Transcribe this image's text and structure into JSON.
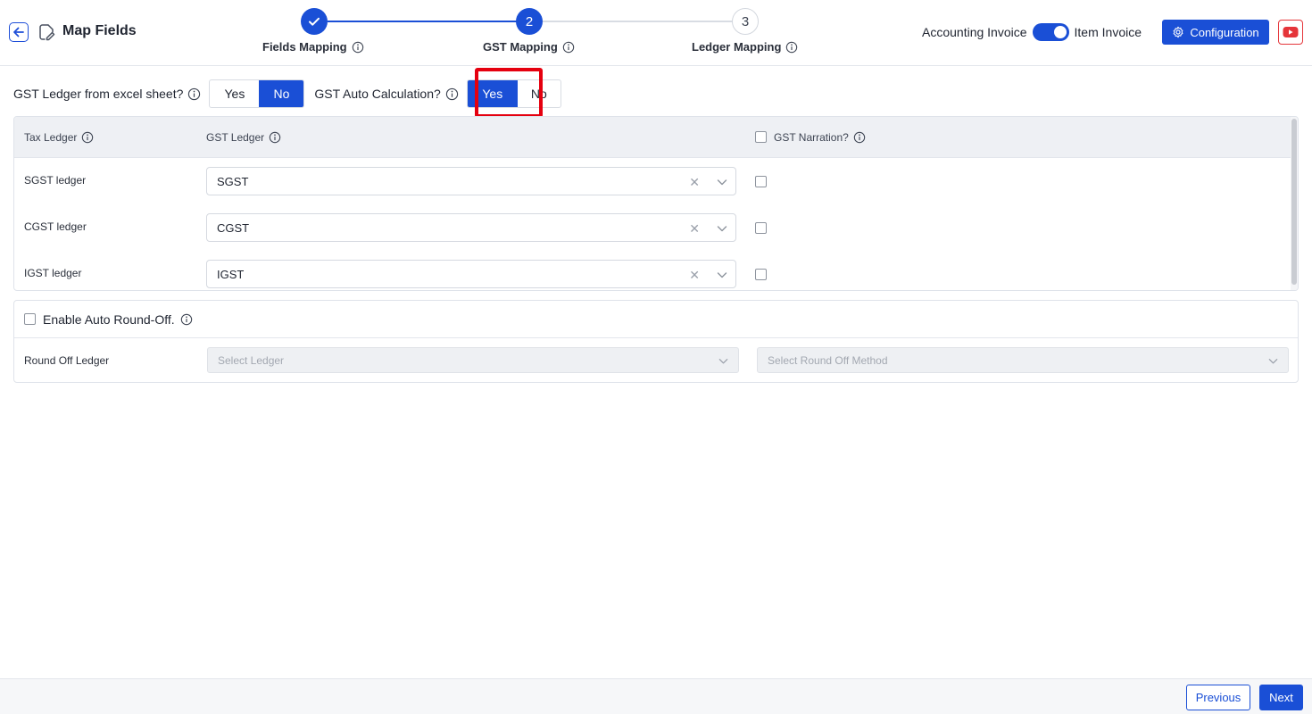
{
  "header": {
    "title": "Map Fields",
    "steps": [
      {
        "number": "1",
        "label": "Fields Mapping",
        "state": "completed"
      },
      {
        "number": "2",
        "label": "GST Mapping",
        "state": "active"
      },
      {
        "number": "3",
        "label": "Ledger Mapping",
        "state": "pending"
      }
    ],
    "toggle": {
      "left_label": "Accounting Invoice",
      "right_label": "Item Invoice",
      "selected": "Item Invoice"
    },
    "config_label": "Configuration"
  },
  "questions": {
    "gst_ledger_excel": {
      "label": "GST Ledger from excel sheet?",
      "yes": "Yes",
      "no": "No",
      "selected": "No"
    },
    "gst_auto_calc": {
      "label": "GST Auto Calculation?",
      "yes": "Yes",
      "no": "No",
      "selected": "Yes"
    }
  },
  "table": {
    "columns": {
      "tax_ledger": "Tax Ledger",
      "gst_ledger": "GST Ledger",
      "gst_narration": "GST Narration?"
    },
    "rows": [
      {
        "label": "SGST ledger",
        "value": "SGST",
        "narration": false
      },
      {
        "label": "CGST ledger",
        "value": "CGST",
        "narration": false
      },
      {
        "label": "IGST ledger",
        "value": "IGST",
        "narration": false
      }
    ]
  },
  "round_off": {
    "title": "Enable Auto Round-Off.",
    "enabled": false,
    "row_label": "Round Off Ledger",
    "ledger_placeholder": "Select Ledger",
    "method_placeholder": "Select Round Off Method"
  },
  "footer": {
    "previous": "Previous",
    "next": "Next"
  },
  "colors": {
    "accent": "#1a4fd6",
    "highlight": "#e5000f",
    "youtube": "#e5353a"
  },
  "icons": [
    "back-arrow-icon",
    "edit-document-icon",
    "check-icon",
    "info-icon",
    "gear-icon",
    "youtube-icon",
    "clear-icon",
    "chevron-down-icon"
  ]
}
